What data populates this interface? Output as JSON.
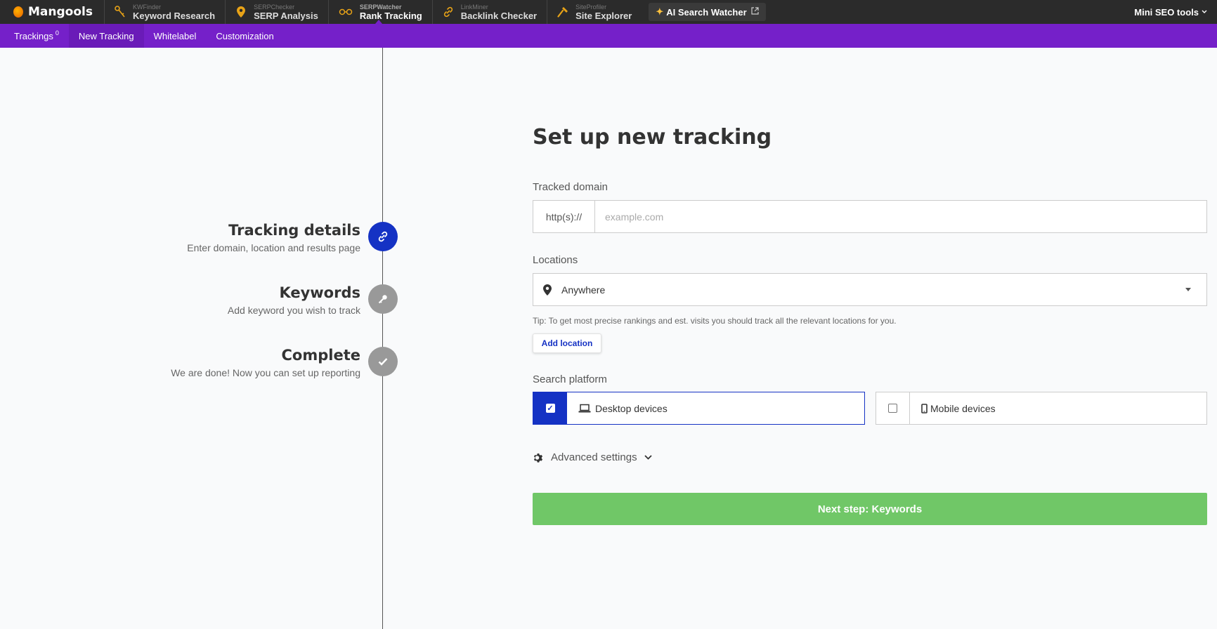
{
  "brand": {
    "name": "Mangools"
  },
  "tools": [
    {
      "sub": "KWFinder",
      "main": "Keyword Research",
      "icon": "key-icon"
    },
    {
      "sub": "SERPChecker",
      "main": "SERP Analysis",
      "icon": "map-pin-icon"
    },
    {
      "sub": "SERPWatcher",
      "main": "Rank Tracking",
      "icon": "glasses-icon"
    },
    {
      "sub": "LinkMiner",
      "main": "Backlink Checker",
      "icon": "link-icon"
    },
    {
      "sub": "SiteProfiler",
      "main": "Site Explorer",
      "icon": "hammer-icon"
    }
  ],
  "ai_button": {
    "label": "AI Search Watcher",
    "icon": "sparkle-icon"
  },
  "mini_tools": {
    "label": "Mini SEO tools"
  },
  "subnav": {
    "trackings": "Trackings",
    "trackings_count": "0",
    "new_tracking": "New Tracking",
    "whitelabel": "Whitelabel",
    "customization": "Customization"
  },
  "steps": [
    {
      "title": "Tracking details",
      "desc": "Enter domain, location and results page",
      "icon": "link-icon",
      "state": "active"
    },
    {
      "title": "Keywords",
      "desc": "Add keyword you wish to track",
      "icon": "key-icon",
      "state": "pending"
    },
    {
      "title": "Complete",
      "desc": "We are done! Now you can set up reporting",
      "icon": "check-icon",
      "state": "pending"
    }
  ],
  "form": {
    "title": "Set up new tracking",
    "domain_label": "Tracked domain",
    "domain_prefix": "http(s)://",
    "domain_placeholder": "example.com",
    "domain_value": "",
    "locations_label": "Locations",
    "location_value": "Anywhere",
    "tip": "Tip: To get most precise rankings and est. visits you should track all the relevant locations for you.",
    "add_location": "Add location",
    "platform_label": "Search platform",
    "desktop_label": "Desktop devices",
    "desktop_checked": true,
    "mobile_label": "Mobile devices",
    "mobile_checked": false,
    "advanced_label": "Advanced settings",
    "next_button": "Next step: Keywords"
  },
  "colors": {
    "topbar": "#2b2b2b",
    "subnav": "#7520c9",
    "primary_blue": "#1532c4",
    "success_green": "#70c767",
    "accent_orange": "#e8a317"
  }
}
